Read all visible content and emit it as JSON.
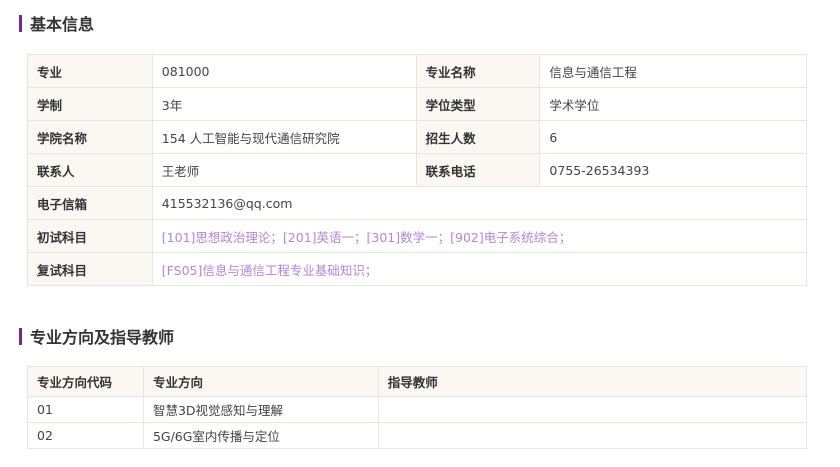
{
  "basic": {
    "title": "基本信息",
    "major_label": "专业",
    "major_value": "081000",
    "major_name_label": "专业名称",
    "major_name_value": "信息与通信工程",
    "duration_label": "学制",
    "duration_value": "3年",
    "degree_type_label": "学位类型",
    "degree_type_value": "学术学位",
    "college_label": "学院名称",
    "college_value": "154 人工智能与现代通信研究院",
    "quota_label": "招生人数",
    "quota_value": "6",
    "contact_label": "联系人",
    "contact_value": "王老师",
    "phone_label": "联系电话",
    "phone_value": "0755-26534393",
    "email_label": "电子信箱",
    "email_value": "415532136@qq.com",
    "exam_label": "初试科目",
    "exam_value": "[101]思想政治理论；[201]英语一；[301]数学一；[902]电子系统综合；",
    "retest_label": "复试科目",
    "retest_value": "[FS05]信息与通信工程专业基础知识；"
  },
  "directions": {
    "title": "专业方向及指导教师",
    "headers": [
      "专业方向代码",
      "专业方向",
      "指导教师"
    ],
    "rows": [
      {
        "code": "01",
        "name": "智慧3D视觉感知与理解",
        "advisor": ""
      },
      {
        "code": "02",
        "name": "5G/6G室内传播与定位",
        "advisor": ""
      }
    ]
  },
  "colors": {
    "accent": "#6a2c8f",
    "link": "#b485d6",
    "label_bg": "#fbf8f4",
    "border": "#e9e4de"
  }
}
